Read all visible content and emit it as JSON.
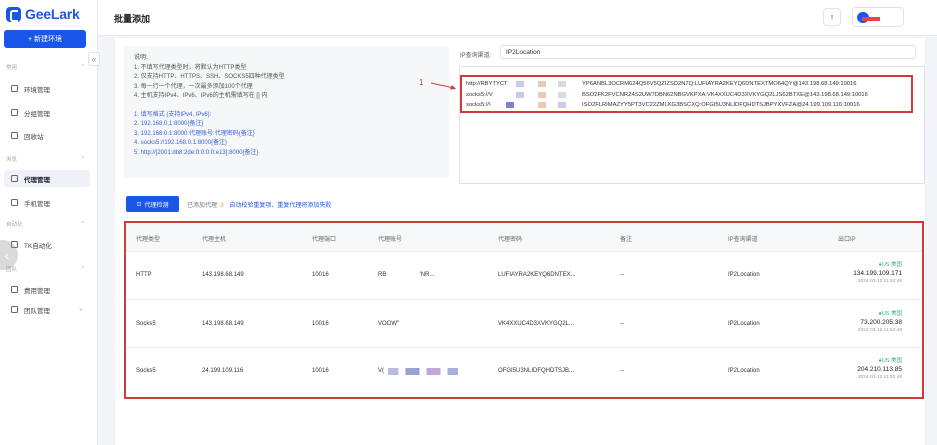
{
  "app": {
    "name": "GeeLark",
    "brand_color": "#1a56e8",
    "alert_color": "#d23a3a"
  },
  "sidebar": {
    "new_env_label": "+ 新建环境",
    "collapse_glyph": "«",
    "groups": [
      {
        "label": "常用",
        "arrow": "^"
      },
      {
        "label": "浏览",
        "arrow": "^"
      },
      {
        "label": "自动化",
        "arrow": "^"
      },
      {
        "label": "团队",
        "arrow": "^"
      }
    ],
    "items": [
      {
        "label": "环境管理",
        "icon": "browser-icon"
      },
      {
        "label": "分组管理",
        "icon": "list-icon"
      },
      {
        "label": "回收站",
        "icon": "trash-icon"
      },
      {
        "label": "代理管理",
        "icon": "proxy-icon"
      },
      {
        "label": "手机管理",
        "icon": "phone-icon"
      },
      {
        "label": "TK自动化",
        "icon": "tiktok-icon"
      },
      {
        "label": "费用管理",
        "icon": "bill-icon"
      },
      {
        "label": "团队管理",
        "icon": "team-icon"
      }
    ],
    "team_arrow": "v"
  },
  "header": {
    "title": "批量添加",
    "upload_glyph": "↑"
  },
  "instructions": {
    "title": "说明:",
    "lines": [
      "1. 不填写代理类型时，将默认为HTTP类型",
      "2. 仅支持HTTP、HTTPS、SSH、SOCKS5四种代理类型",
      "3. 每一行一个代理，一次最多添加100个代理",
      "4. 主机支持IPv4、IPv6、IPv6的主机需填写在 [] 内"
    ],
    "formats": [
      "1. 填写格式 (支持IPv4, IPv6):",
      "2. 192.168.0.1:8000{备注}",
      "3. 192.168.0.1:8000:代理账号:代理密码{备注}",
      "4. socks5://192.168.0.1:8000{备注}",
      "5. http://[2001:db8:2de:0:0:0:0:e13]:8000{备注}"
    ]
  },
  "query": {
    "label": "IP查询渠道:",
    "value": "IP2Location"
  },
  "proxy_input": {
    "annotation": "1",
    "lines": [
      {
        "prefix": "http://RBYTYCT",
        "tail": "YP6ANBL3OCRM624Q56V5QZIZSD2N7Q:LUFIAYRA2KEYQ6DNTEXTMO64QY@143.198.68.149:10016"
      },
      {
        "prefix": "socks5://V",
        "tail": "BSO2FK2FVCNRZ4S2UW7DBN62NBGVKPXA:VK4XXUC4D3XVKYGQ2LJS62BTXE@143.198.68.149:10016"
      },
      {
        "prefix": "socks5://\\",
        "tail": "ISO2FLRIMAZYY5PT3VC22ZMLKG3BSCXQ:OFGI5U3NLIDFQHDTSJBPYXVFZA@24.199.109.116:10016"
      }
    ]
  },
  "toolbar": {
    "detect_label": "代理检测",
    "added_label": "已添加代理:",
    "added_count": "3",
    "added_hint": "自动校验重复项、重复代理将添加失败"
  },
  "table": {
    "headers": [
      "代理类型",
      "代理主机",
      "代理端口",
      "代理账号",
      "代理密码",
      "备注",
      "IP查询渠道",
      "出口IP"
    ],
    "rows": [
      {
        "type": "HTTP",
        "host": "143.198.68.149",
        "port": "10016",
        "account": "RB                    'NR...",
        "password": "LUFIAYRA2KEYQ6DNTEX...",
        "note": "--",
        "channel": "IP2Location",
        "flag": "●US 美国",
        "exit_ip": "134.199.109.171",
        "time": "2024-03-12 11:52:48"
      },
      {
        "type": "Socks5",
        "host": "143.198.68.149",
        "port": "10016",
        "account": "VOOW\"",
        "password": "VK4XXUC4D3XVKYGQ2L...",
        "note": "--",
        "channel": "IP2Location",
        "flag": "●US 美国",
        "exit_ip": "73.200.205.38",
        "time": "2024-03-12 11:52:49"
      },
      {
        "type": "Socks5",
        "host": "24.199.109.116",
        "port": "10016",
        "account": "V(",
        "password": "OFGI5U3NLIDFQHDTSJB...",
        "note": "--",
        "channel": "IP2Location",
        "flag": "●US 美国",
        "exit_ip": "204.210.113.85",
        "time": "2024-03-12 11:52:48"
      }
    ]
  }
}
